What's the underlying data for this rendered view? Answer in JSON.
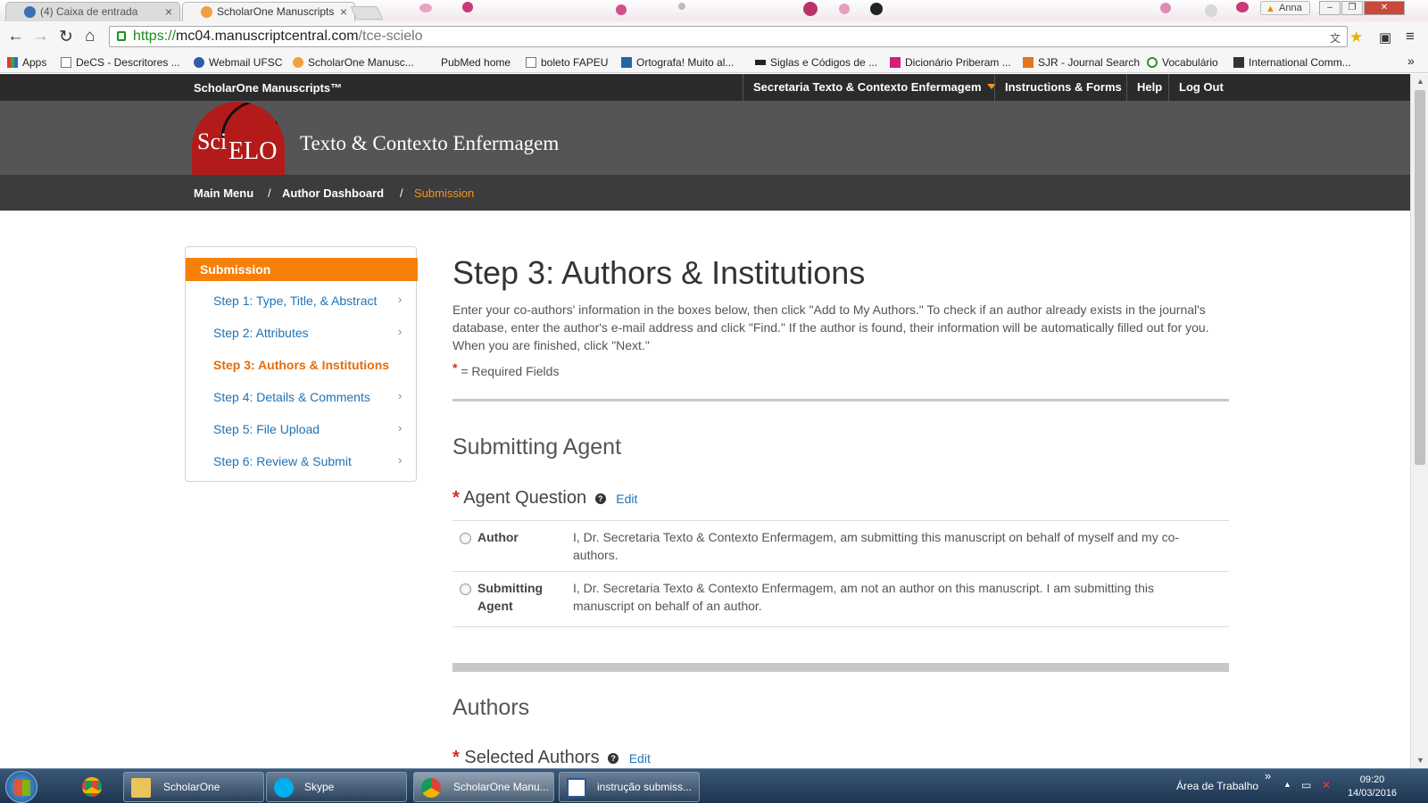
{
  "browser": {
    "tabs": [
      {
        "label": "(4) Caixa de entrada",
        "active": false
      },
      {
        "label": "ScholarOne Manuscripts",
        "active": true
      }
    ],
    "close_glyph": "×",
    "user": "Anna",
    "url": {
      "scheme": "https://",
      "host": "mc04.manuscriptcentral.com",
      "path": "/tce-scielo"
    },
    "bookmarks": [
      "Apps",
      "DeCS - Descritores ...",
      "Webmail UFSC",
      "ScholarOne Manusc...",
      "PubMed home",
      "boleto FAPEU",
      "Ortografa! Muito al...",
      "Siglas e Códigos de ...",
      "Dicionário Priberam ...",
      "SJR - Journal Search",
      "Vocabulário",
      "International Comm..."
    ],
    "bookmarks_overflow": "»"
  },
  "site": {
    "brand": "ScholarOne Manuscripts™",
    "nav": {
      "account": "Secretaria Texto & Contexto Enfermagem",
      "instructions": "Instructions & Forms",
      "help": "Help",
      "logout": "Log Out"
    },
    "logo": {
      "sci": "Sci",
      "elo": "ELO"
    },
    "journal_title": "Texto & Contexto Enfermagem",
    "breadcrumb": {
      "main_menu": "Main Menu",
      "sep": "/",
      "dashboard": "Author Dashboard",
      "current": "Submission"
    },
    "accent_color": "#f7941d"
  },
  "sidebar": {
    "header": "Submission",
    "chevron": "›",
    "items": [
      {
        "label": "Step 1: Type, Title, & Abstract",
        "current": false
      },
      {
        "label": "Step 2: Attributes",
        "current": false
      },
      {
        "label": "Step 3: Authors & Institutions",
        "current": true
      },
      {
        "label": "Step 4: Details & Comments",
        "current": false
      },
      {
        "label": "Step 5: File Upload",
        "current": false
      },
      {
        "label": "Step 6: Review & Submit",
        "current": false
      }
    ]
  },
  "main": {
    "title": "Step 3: Authors & Institutions",
    "intro": "Enter your co-authors' information in the boxes below, then click \"Add to My Authors.\" To check if an author already exists in the journal's database, enter the author's e-mail address and click \"Find.\" If the author is found, their information will be automatically filled out for you. When you are finished, click \"Next.\"",
    "required_star": "*",
    "required_note": "= Required Fields",
    "submitting_agent": {
      "heading": "Submitting Agent",
      "question": "Agent Question",
      "help": "?",
      "edit": "Edit",
      "options": [
        {
          "label": "Author",
          "desc": "I, Dr. Secretaria Texto & Contexto Enfermagem, am submitting this manuscript on behalf of myself and my co-authors."
        },
        {
          "label": "Submitting Agent",
          "desc": "I, Dr. Secretaria Texto & Contexto Enfermagem, am not an author on this manuscript. I am submitting this manuscript on behalf of an author."
        }
      ]
    },
    "authors": {
      "heading": "Authors",
      "selected_label": "Selected Authors",
      "edit": "Edit"
    }
  },
  "taskbar": {
    "items": [
      {
        "label": "ScholarOne",
        "icon": "folder-icon"
      },
      {
        "label": "Skype",
        "icon": "skype-icon"
      },
      {
        "label": "ScholarOne Manu...",
        "icon": "chrome-icon",
        "active": true
      },
      {
        "label": "instrução submiss...",
        "icon": "word-icon"
      }
    ],
    "desktop_label": "Área de Trabalho",
    "desktop_chevron": "»",
    "time": "09:20",
    "date": "14/03/2016"
  }
}
